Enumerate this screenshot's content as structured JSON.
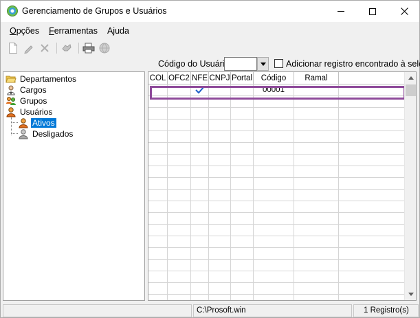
{
  "window": {
    "title": "Gerenciamento de Grupos e Usuários"
  },
  "menu": {
    "items": [
      {
        "label": "Opções",
        "mnemonic": "O",
        "rest": "pções"
      },
      {
        "label": "Ferramentas",
        "mnemonic": "F",
        "rest": "erramentas"
      },
      {
        "label": "Ajuda",
        "mnemonic": "",
        "rest": "Ajuda"
      }
    ]
  },
  "toolbar": {
    "icons": [
      "new-document-icon",
      "edit-pencil-icon",
      "delete-x-icon",
      "handshake-icon",
      "printer-icon",
      "globe-icon"
    ]
  },
  "search": {
    "label": "Código do Usuário:",
    "value": "",
    "checkbox_label": "Adicionar registro encontrado à seleção",
    "checkbox_checked": false
  },
  "tree": {
    "items": [
      {
        "label": "Departamentos",
        "icon": "folder-open-icon",
        "level": 0,
        "selected": false
      },
      {
        "label": "Cargos",
        "icon": "briefcase-person-icon",
        "level": 0,
        "selected": false
      },
      {
        "label": "Grupos",
        "icon": "group-users-icon",
        "level": 0,
        "selected": false
      },
      {
        "label": "Usuários",
        "icon": "user-icon",
        "level": 0,
        "selected": false
      },
      {
        "label": "Ativos",
        "icon": "user-active-icon",
        "level": 1,
        "selected": true
      },
      {
        "label": "Desligados",
        "icon": "user-inactive-icon",
        "level": 1,
        "selected": false
      }
    ]
  },
  "grid": {
    "columns": [
      "COL",
      "OFC2",
      "NFE",
      "CNPJ",
      "Portal",
      "Código",
      "Ramal"
    ],
    "rows": [
      {
        "COL": "",
        "OFC2": "",
        "NFE": "✔",
        "CNPJ": "",
        "Portal": "",
        "Código": "00001",
        "Ramal": ""
      }
    ],
    "empty_rows": 18,
    "accent": "#8e4a9a"
  },
  "status": {
    "left": "",
    "path": "C:\\Prosoft.win",
    "count": "1 Registro(s)"
  }
}
